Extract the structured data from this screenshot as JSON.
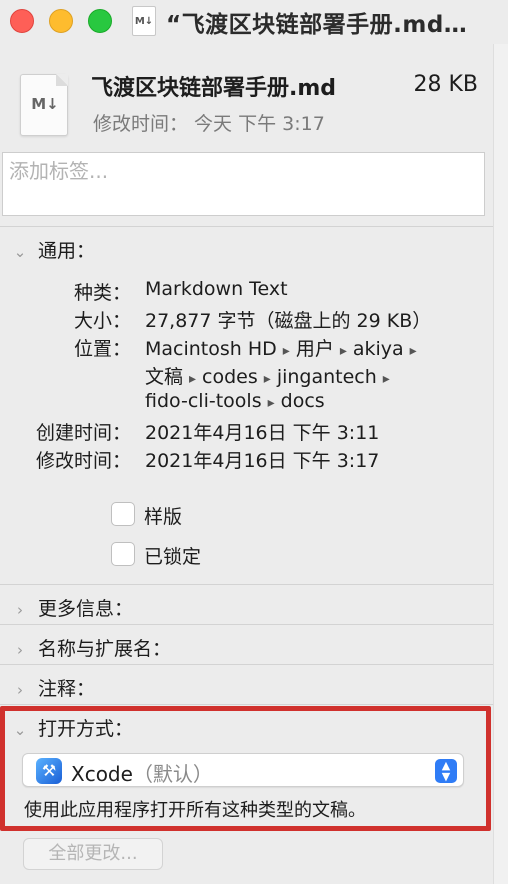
{
  "window": {
    "title": "“飞渡区块链部署手册.md…",
    "doc_badge": "M↓"
  },
  "file": {
    "name": "飞渡区块链部署手册.md",
    "size": "28 KB",
    "modified_line": "修改时间：  今天 下午 3:17",
    "badge": "M↓"
  },
  "tags": {
    "placeholder": "添加标签..."
  },
  "general": {
    "title": "通用：",
    "kind_label": "种类：",
    "kind_value": "Markdown Text",
    "size_label": "大小：",
    "size_value": "27,877 字节（磁盘上的 29 KB）",
    "where_label": "位置：",
    "path": [
      "Macintosh HD",
      "用户",
      "akiya",
      "文稿",
      "codes",
      "jingantech",
      "fido-cli-tools",
      "docs"
    ],
    "path_sep": "▸",
    "created_label": "创建时间：",
    "created_value": "2021年4月16日 下午 3:11",
    "modified_label": "修改时间：",
    "modified_value": "2021年4月16日 下午 3:17",
    "stationery_label": "样版",
    "locked_label": "已锁定"
  },
  "sections": {
    "more_info": "更多信息：",
    "name_ext": "名称与扩展名：",
    "comments": "注释：",
    "open_with": "打开方式："
  },
  "open_with": {
    "app": "Xcode",
    "app_default": "（默认）",
    "hint": "使用此应用程序打开所有这种类型的文稿。",
    "change_all": "全部更改..."
  },
  "colors": {
    "highlight_box": "#d0312d",
    "accent": "#2f7cf6"
  }
}
